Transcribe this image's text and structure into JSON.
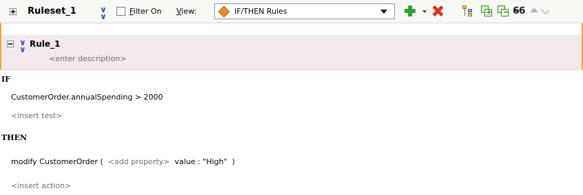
{
  "toolbar": {
    "ruleset_name": "Ruleset_1",
    "filter_label_prefix": "F",
    "filter_label_rest": "ilter On",
    "view_label_prefix": "V",
    "view_label_rest": "iew:",
    "view_selected": "IF/THEN Rules",
    "filter_checked": false
  },
  "rule": {
    "name": "Rule_1",
    "description_placeholder": "<enter description>",
    "if_keyword": "IF",
    "test": "CustomerOrder.annualSpending  >  2000",
    "insert_test_placeholder": "<insert test>",
    "then_keyword": "THEN",
    "action_prefix": "modify CustomerOrder (  ",
    "action_add_property": "<add property>",
    "action_suffix": "  value : \"High\"  )",
    "insert_action_placeholder": "<insert action>"
  },
  "icons": {
    "expand": "expand-icon",
    "collapse": "collapse-icon",
    "advanced_settings": "double-chevron-icon",
    "add": "plus-icon",
    "delete": "delete-icon",
    "tree": "tree-icon",
    "copy": "copy-icon",
    "move": "move-icon",
    "show": "glasses-icon",
    "up": "up-icon",
    "down": "down-icon"
  },
  "colors": {
    "rule_accent": "#f2a23a",
    "rule_header_bg": "#f3e9ec",
    "add_green": "#2fa52f",
    "delete_red": "#d43a1c",
    "placeholder_gray": "#6e6e6e"
  }
}
